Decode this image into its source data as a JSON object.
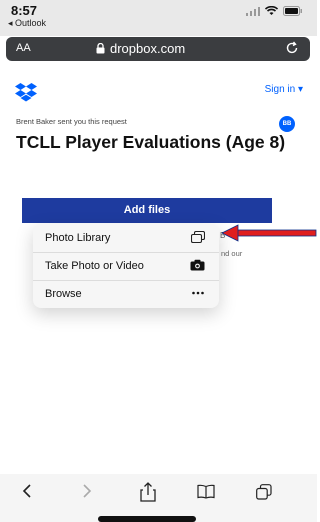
{
  "status_bar": {
    "time": "8:57",
    "back_app": "◂ Outlook"
  },
  "url_bar": {
    "text_size": "AA",
    "domain": "dropbox.com"
  },
  "page": {
    "sign_in": "Sign in ▾",
    "sender_note": "Brent Baker sent you this request",
    "avatar_initials": "BB",
    "title": "TCLL Player Evaluations (Age 8)",
    "add_files": "Add files",
    "side_fragment_1": "B",
    "side_fragment_2": "nd our"
  },
  "menu": {
    "items": [
      {
        "label": "Photo Library",
        "icon": "photo-library-icon"
      },
      {
        "label": "Take Photo or Video",
        "icon": "camera-icon"
      },
      {
        "label": "Browse",
        "icon": "more-icon"
      }
    ]
  },
  "colors": {
    "dropbox_blue": "#0061fe",
    "add_files_bg": "#1e3b9f",
    "arrow_red": "#e01e1e"
  }
}
